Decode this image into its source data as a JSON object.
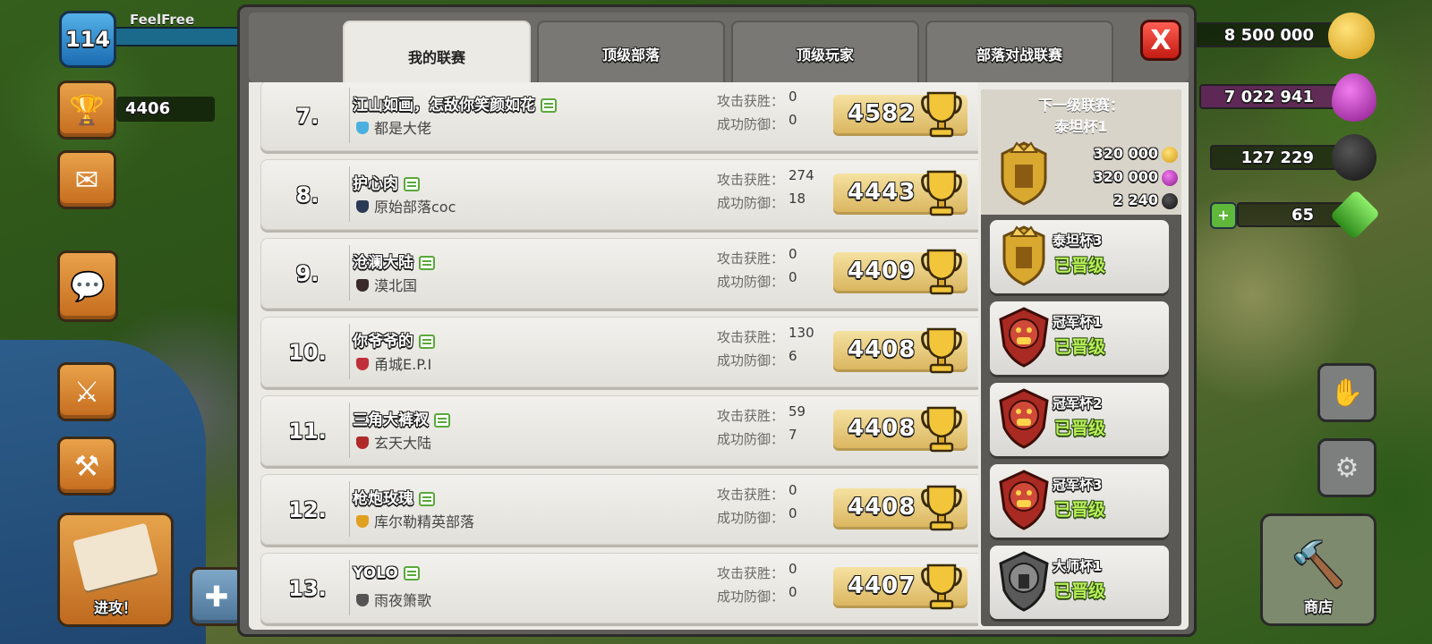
{
  "player": {
    "level": "114",
    "name": "FeelFree",
    "trophies": "4406"
  },
  "resources": {
    "gold": "8 500 000",
    "elixir": "7 022 941",
    "dark_elixir": "127 229",
    "gems": "65"
  },
  "left_buttons": {
    "attack_label": "进攻！"
  },
  "right_buttons": {
    "shop_label": "商店"
  },
  "tabs": [
    "我的联赛",
    "顶级部落",
    "顶级玩家",
    "部落对战联赛"
  ],
  "close_label": "X",
  "row_labels": {
    "attack_wins": "攻击获胜：",
    "defense_wins": "成功防御："
  },
  "rows": [
    {
      "rank": "7.",
      "name": "江山如画，怎敌你笑颜如花",
      "clan": "都是大佬",
      "attack": "0",
      "defense": "0",
      "trophies": "4582",
      "badge": "#4ab0e0"
    },
    {
      "rank": "8.",
      "name": "护心肉",
      "clan": "原始部落coc",
      "attack": "274",
      "defense": "18",
      "trophies": "4443",
      "badge": "#2b3a55"
    },
    {
      "rank": "9.",
      "name": "沧澜大陆",
      "clan": "漠北国",
      "attack": "0",
      "defense": "0",
      "trophies": "4409",
      "badge": "#3a2a2a"
    },
    {
      "rank": "10.",
      "name": "你爷爷的",
      "clan": "甬城E.P.I",
      "attack": "130",
      "defense": "6",
      "trophies": "4408",
      "badge": "#c0303a"
    },
    {
      "rank": "11.",
      "name": "三角大裤衩",
      "clan": "玄天大陆",
      "attack": "59",
      "defense": "7",
      "trophies": "4408",
      "badge": "#b02a2a"
    },
    {
      "rank": "12.",
      "name": "枪炮玫瑰",
      "clan": "库尔勒精英部落",
      "attack": "0",
      "defense": "0",
      "trophies": "4408",
      "badge": "#e0a020"
    },
    {
      "rank": "13.",
      "name": "YOLO",
      "clan": "雨夜箫歌",
      "attack": "0",
      "defense": "0",
      "trophies": "4407",
      "badge": "#555555"
    }
  ],
  "next_league": {
    "title": "下一级联赛：",
    "name": "泰坦杯1",
    "rewards": [
      "320 000",
      "320 000",
      "2 240"
    ]
  },
  "leagues": [
    {
      "name": "泰坦杯3",
      "status": "已晋级",
      "type": "titan"
    },
    {
      "name": "冠军杯1",
      "status": "已晋级",
      "type": "champion"
    },
    {
      "name": "冠军杯2",
      "status": "已晋级",
      "type": "champion"
    },
    {
      "name": "冠军杯3",
      "status": "已晋级",
      "type": "champion"
    },
    {
      "name": "大师杯1",
      "status": "已晋级",
      "type": "master"
    }
  ],
  "colors": {
    "gold": "#f2c53a",
    "elixir": "#c83ac8",
    "dark_elixir": "#222222",
    "gem": "#4fc23a",
    "promoted": "#b9f05a",
    "close": "#e0261b"
  }
}
